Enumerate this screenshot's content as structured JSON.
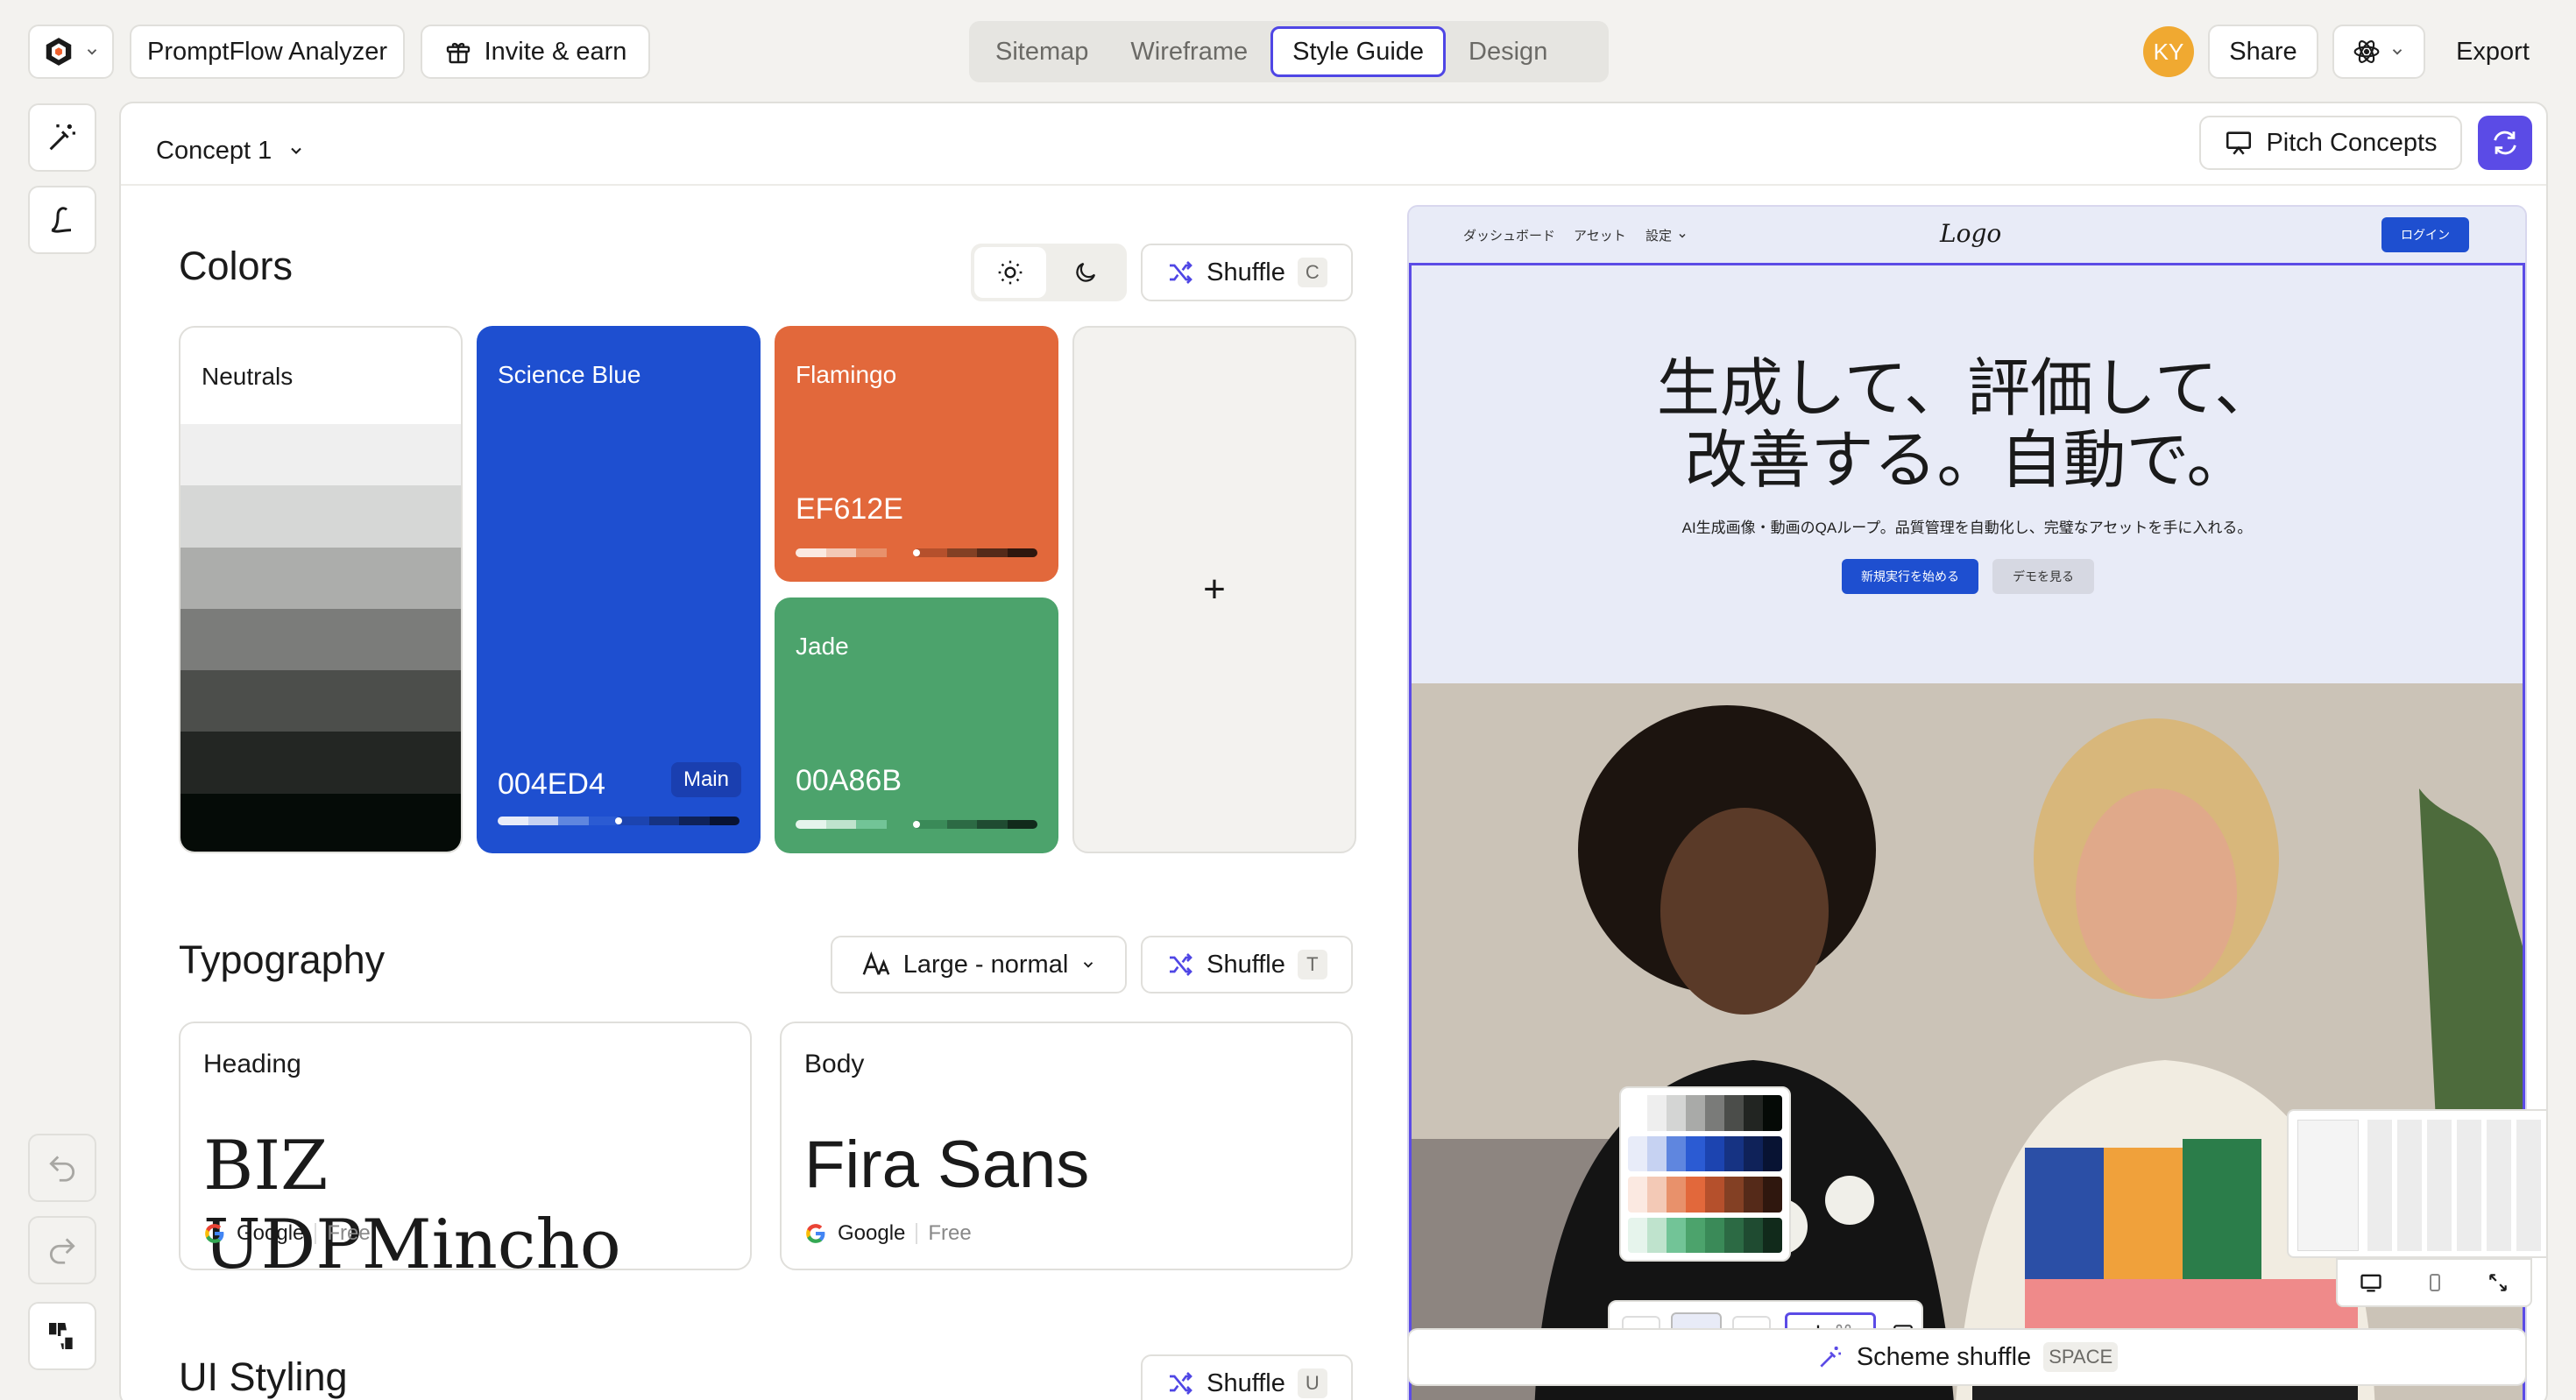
{
  "topbar": {
    "project_name": "PromptFlow Analyzer",
    "invite_label": "Invite & earn",
    "tabs": [
      "Sitemap",
      "Wireframe",
      "Style Guide",
      "Design"
    ],
    "active_tab": "Style Guide",
    "avatar_initials": "KY",
    "share_label": "Share",
    "export_label": "Export"
  },
  "panel": {
    "concept_label": "Concept 1",
    "pitch_label": "Pitch Concepts"
  },
  "colors": {
    "title": "Colors",
    "shuffle_label": "Shuffle",
    "shuffle_key": "C",
    "neutrals": {
      "name": "Neutrals",
      "shades": [
        "#ffffff",
        "#efefef",
        "#d6d7d6",
        "#acadab",
        "#7b7c7a",
        "#4c4e4b",
        "#232623",
        "#050b07"
      ]
    },
    "science_blue": {
      "name": "Science Blue",
      "hex": "004ED4",
      "badge": "Main",
      "color": "#1e4fd0"
    },
    "flamingo": {
      "name": "Flamingo",
      "hex": "EF612E",
      "color": "#e2683b"
    },
    "jade": {
      "name": "Jade",
      "hex": "00A86B",
      "color": "#4ca36c"
    },
    "add_symbol": "+"
  },
  "typography": {
    "title": "Typography",
    "size_label": "Large - normal",
    "shuffle_label": "Shuffle",
    "shuffle_key": "T",
    "heading": {
      "label": "Heading",
      "font": "BIZ UDPMincho",
      "source": "Google",
      "price": "Free"
    },
    "body": {
      "label": "Body",
      "font": "Fira Sans",
      "source": "Google",
      "price": "Free"
    }
  },
  "ui_styling": {
    "title": "UI Styling",
    "shuffle_label": "Shuffle",
    "shuffle_key": "U"
  },
  "preview": {
    "nav": [
      "ダッシュボード",
      "アセット",
      "設定"
    ],
    "logo": "Logo",
    "login": "ログイン",
    "headline_1": "生成して、評価して、",
    "headline_2": "改善する。自動で。",
    "subtext": "AI生成画像・動画のQAループ。品質管理を自動化し、完璧なアセットを手に入れる。",
    "cta_primary": "新規実行を始める",
    "cta_secondary": "デモを見る",
    "scheme_shuffle_label": "Scheme shuffle",
    "scheme_shuffle_key": "SPACE"
  },
  "palette_popup": {
    "rows": [
      [
        "#ffffff",
        "#eeeeee",
        "#d4d5d4",
        "#a9aaa8",
        "#7a7b79",
        "#4b4d4a",
        "#222522",
        "#050a06"
      ],
      [
        "#e8ecf9",
        "#c6d2f2",
        "#5f86df",
        "#2b5bd3",
        "#1c44b0",
        "#163383",
        "#0f2259",
        "#081333"
      ],
      [
        "#fbe9e1",
        "#f3c9b6",
        "#e8916b",
        "#e2683b",
        "#b5502c",
        "#834024",
        "#552a19",
        "#2f170e"
      ],
      [
        "#e6f4ec",
        "#bfe3cd",
        "#72c497",
        "#4ca36c",
        "#3a8a58",
        "#2c6a44",
        "#1f4b31",
        "#112a1b"
      ]
    ]
  }
}
